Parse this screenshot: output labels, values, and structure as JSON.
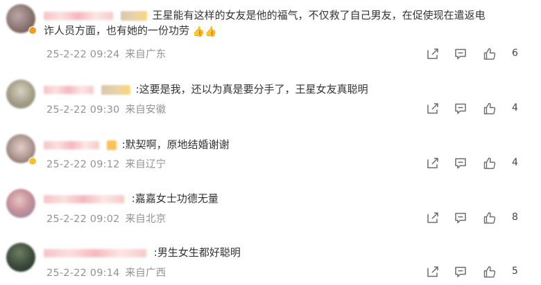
{
  "comments": [
    {
      "name": "",
      "text_line1": "王星能有这样的女友是他的福气，不仅救了自己男友，在促使现在遣返电",
      "text_line2": "诈人员方面，也有她的一份功劳",
      "emoji": "👍👍",
      "date": "25-2-22 09:24",
      "location": "来自广东",
      "likes": "6",
      "avatar_colors": [
        "#bba8a8",
        "#7d6560"
      ],
      "badge_color": "#f39a2b"
    },
    {
      "name": "",
      "text_line1": ":这要是我，还以为真是要分手了，王星女友真聪明",
      "date": "25-2-22 09:30",
      "location": "来自安徽",
      "likes": "4",
      "avatar_colors": [
        "#d7d2c3",
        "#8d8774"
      ],
      "badge_color": ""
    },
    {
      "name": "",
      "text_line1": ":默契啊，原地结婚谢谢",
      "date": "25-2-22 09:12",
      "location": "来自辽宁",
      "likes": "4",
      "avatar_colors": [
        "#d5bfb8",
        "#6f5552"
      ],
      "badge_color": "#f2c230"
    },
    {
      "name": "",
      "text_line1": ":嘉嘉女士功德无量",
      "date": "25-2-22 09:02",
      "location": "来自北京",
      "likes": "8",
      "avatar_colors": [
        "#d5a5a9",
        "#8a8fa6"
      ],
      "badge_color": ""
    },
    {
      "name": "",
      "text_line1": ":男生女生都好聪明",
      "date": "25-2-22 09:14",
      "location": "来自广西",
      "likes": "5",
      "avatar_colors": [
        "#506048",
        "#1f2a22"
      ],
      "badge_color": ""
    }
  ],
  "icons": {
    "share": "share-icon",
    "comment": "comment-icon",
    "like": "thumbs-up-icon"
  }
}
